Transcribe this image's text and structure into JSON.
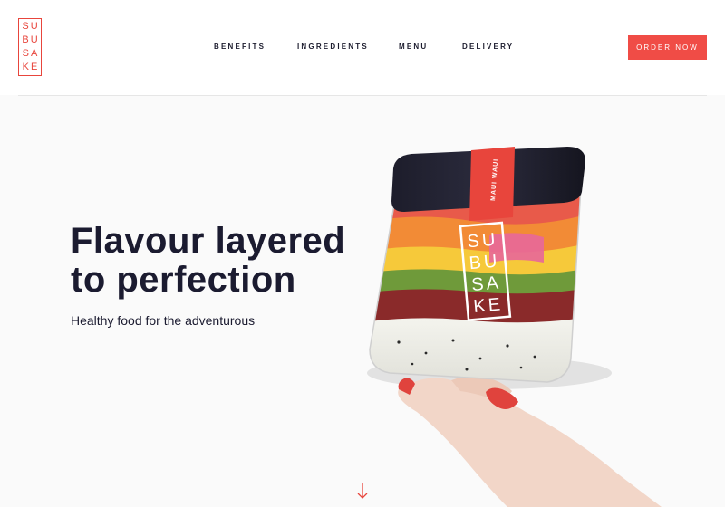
{
  "brand": {
    "logo_lines": [
      "SU",
      "BU",
      "SA",
      "KE"
    ],
    "accent_color": "#f04c46"
  },
  "nav": {
    "items": [
      {
        "label": "BENEFITS"
      },
      {
        "label": "INGREDIENTS"
      },
      {
        "label": "MENU"
      },
      {
        "label": "DELIVERY"
      }
    ],
    "order_label": "ORDER NOW"
  },
  "hero": {
    "title_line1": "Flavour layered",
    "title_line2": "to perfection",
    "subtitle": "Healthy food for the adventurous",
    "jar_label": "MAUI WAUI",
    "jar_logo_lines": [
      "SU",
      "BU",
      "SA",
      "KE"
    ]
  },
  "icons": {
    "scroll": "arrow-down-icon"
  }
}
